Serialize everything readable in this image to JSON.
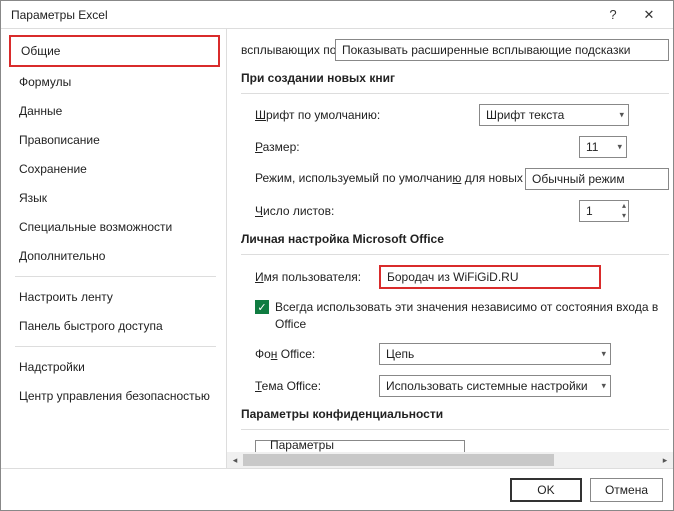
{
  "window": {
    "title": "Параметры Excel"
  },
  "sidebar": {
    "items": [
      {
        "label": "Общие",
        "active": true
      },
      {
        "label": "Формулы"
      },
      {
        "label": "Данные"
      },
      {
        "label": "Правописание"
      },
      {
        "label": "Сохранение"
      },
      {
        "label": "Язык"
      },
      {
        "label": "Специальные возможности"
      },
      {
        "label": "Дополнительно"
      }
    ],
    "items2": [
      {
        "label": "Настроить ленту"
      },
      {
        "label": "Панель быстрого доступа"
      }
    ],
    "items3": [
      {
        "label": "Надстройки"
      },
      {
        "label": "Центр управления безопасностью"
      }
    ]
  },
  "content": {
    "tooltips_label": "всплывающих подсказок:",
    "tooltips_value": "Показывать расширенные всплывающие подсказки",
    "section_newbooks": "При создании новых книг",
    "font_label": "Шрифт по умолчанию:",
    "font_value": "Шрифт текста",
    "size_label": "Размер:",
    "size_value": "11",
    "mode_label": "Режим, используемый по умолчанию для новых листов:",
    "mode_value": "Обычный режим",
    "sheets_label": "Число листов:",
    "sheets_value": "1",
    "section_personal": "Личная настройка Microsoft Office",
    "username_label": "Имя пользователя:",
    "username_value": "Бородач из WiFiGiD.RU",
    "always_use_label": "Всегда использовать эти значения независимо от состояния входа в Office",
    "bg_label": "Фон Office:",
    "bg_value": "Цепь",
    "theme_label": "Тема Office:",
    "theme_value": "Использовать системные настройки",
    "section_privacy": "Параметры конфиденциальности",
    "privacy_button": "Параметры конфиденциальности..."
  },
  "footer": {
    "ok": "OK",
    "cancel": "Отмена"
  }
}
